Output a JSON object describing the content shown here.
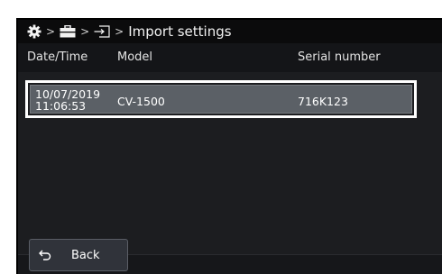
{
  "breadcrumb": {
    "icons": [
      "gear-icon",
      "toolbox-icon",
      "import-icon"
    ],
    "separator": ">",
    "title": "Import settings"
  },
  "table": {
    "headers": {
      "datetime": "Date/Time",
      "model": "Model",
      "serial": "Serial number"
    },
    "rows": [
      {
        "date": "10/07/2019",
        "time": "11:06:53",
        "model": "CV-1500",
        "serial": "716K123",
        "selected": true
      }
    ]
  },
  "footer": {
    "back_label": "Back",
    "back_icon": "return-arrow-icon"
  }
}
